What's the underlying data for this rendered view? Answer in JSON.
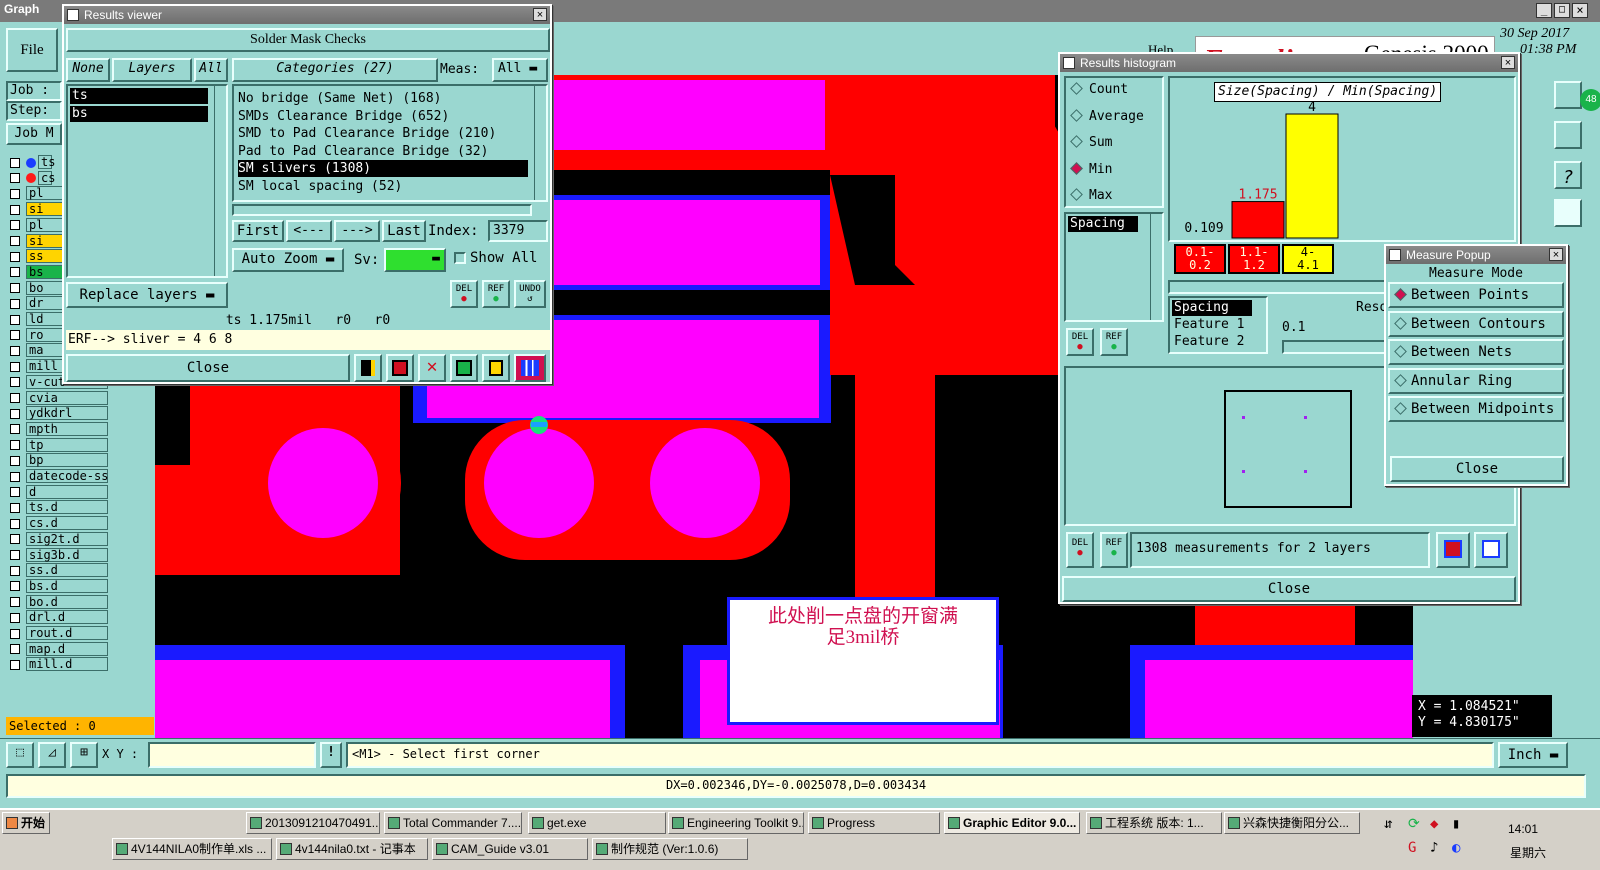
{
  "main_window": {
    "title": "Graph",
    "file_menu": "File",
    "job_label": "Job :",
    "step_label": "Step:",
    "job_btn": "Job M",
    "selected": "Selected : 0",
    "help": "Help",
    "brand_left": "Frontline",
    "brand": "Genesis 2000",
    "date": "30 Sep 2017",
    "time": "01:38 PM"
  },
  "layers": [
    {
      "name": "ts",
      "dot": "#1a3cff"
    },
    {
      "name": "cs",
      "dot": "#ff1a1a"
    },
    {
      "name": "pl"
    },
    {
      "name": "si",
      "color": "#ffd400"
    },
    {
      "name": "pl"
    },
    {
      "name": "si",
      "color": "#ffd400"
    },
    {
      "name": "ss",
      "color": "#ffd400"
    },
    {
      "name": "bs",
      "color": "#19b34a"
    },
    {
      "name": "bo"
    },
    {
      "name": "dr"
    },
    {
      "name": "ld"
    },
    {
      "name": "ro"
    },
    {
      "name": "ma"
    },
    {
      "name": "mill"
    },
    {
      "name": "v-cut"
    },
    {
      "name": "cvia"
    },
    {
      "name": "ydkdrl"
    },
    {
      "name": "mpth"
    },
    {
      "name": "tp"
    },
    {
      "name": "bp"
    },
    {
      "name": "datecode-ss"
    },
    {
      "name": "d"
    },
    {
      "name": "ts.d"
    },
    {
      "name": "cs.d"
    },
    {
      "name": "sig2t.d"
    },
    {
      "name": "sig3b.d"
    },
    {
      "name": "ss.d"
    },
    {
      "name": "bs.d"
    },
    {
      "name": "bo.d"
    },
    {
      "name": "drl.d"
    },
    {
      "name": "rout.d"
    },
    {
      "name": "map.d"
    },
    {
      "name": "mill.d"
    }
  ],
  "results_viewer": {
    "title": "Results viewer",
    "header": "Solder Mask Checks",
    "none_btn": "None",
    "layers_btn": "Layers",
    "all_btn": "All",
    "categories_btn": "Categories (27)",
    "meas_label": "Meas:",
    "meas_value": "All",
    "layer_items": [
      "ts",
      "bs"
    ],
    "categories": [
      "No bridge (Same Net) (168)",
      "SMDs Clearance Bridge (652)",
      "SMD to Pad Clearance Bridge (210)",
      "Pad to Pad Clearance Bridge (32)",
      "SM slivers (1308)",
      "SM local spacing (52)"
    ],
    "first": "First",
    "prev": "<---",
    "next": "--->",
    "last": "Last",
    "index_label": "Index:",
    "index_value": "3379",
    "auto_zoom": "Auto Zoom",
    "sv_label": "Sv:",
    "show_all": "Show All",
    "replace_layers": "Replace layers",
    "status1": "ts 1.175mil   r0   r0",
    "status2": "ERF--> sliver = 4 6 8",
    "close": "Close",
    "del": "DEL",
    "ref": "REF",
    "undo": "UNDO"
  },
  "histogram": {
    "title": "Results histogram",
    "stats": [
      "Count",
      "Average",
      "Sum",
      "Min",
      "Max"
    ],
    "selected_stat": "Min",
    "list_item": "Spacing",
    "chart_title": "Size(Spacing) / Min(Spacing)",
    "bar_labels": [
      "0.109",
      "1.175",
      "4"
    ],
    "bins": [
      "0.1-\n0.2",
      "1.1-\n1.2",
      "4-\n4.1"
    ],
    "spacing_fields": [
      "Spacing",
      "Feature 1",
      "Feature 2"
    ],
    "reso_label": "Reso",
    "reso_value": "0.1",
    "measurements": "1308 measurements for 2 layers",
    "close": "Close",
    "del": "DEL",
    "ref": "REF"
  },
  "chart_data": {
    "type": "bar",
    "title": "Size(Spacing) / Min(Spacing)",
    "categories": [
      "0.1-0.2",
      "1.1-1.2",
      "4-4.1"
    ],
    "values": [
      0.109,
      1.175,
      4
    ],
    "colors": [
      "#ff0000",
      "#ff0000",
      "#ffff00"
    ],
    "ylim": [
      0,
      4
    ]
  },
  "measure_popup": {
    "title": "Measure Popup",
    "mode": "Measure Mode",
    "options": [
      "Between Points",
      "Between Contours",
      "Between Nets",
      "Annular Ring",
      "Between Midpoints"
    ],
    "selected": "Between Points",
    "close": "Close"
  },
  "annotation": {
    "text": "此处削一点盘的开窗满\n足3mil桥"
  },
  "coords": {
    "x": "X = 1.084521\"",
    "y": "Y = 4.830175\""
  },
  "command_bar": {
    "xy_label": "X Y :",
    "message": "<M1> - Select first corner",
    "units": "Inch",
    "excl": "!"
  },
  "status_bar": {
    "text": "DX=0.002346,DY=-0.0025078,D=0.003434"
  },
  "taskbar": {
    "start": "开始",
    "row1": [
      "2013091210470491...",
      "Total Commander 7....",
      "get.exe",
      "Engineering Toolkit 9...",
      "Progress",
      "Graphic Editor 9.0...",
      "工程系统 版本: 1...",
      "兴森快捷衡阳分公..."
    ],
    "row2": [
      "4V144NILA0制作单.xls ...",
      "4v144nila0.txt - 记事本",
      "CAM_Guide v3.01",
      "制作规范 (Ver:1.0.6)"
    ],
    "clock": "14:01",
    "day": "星期六"
  }
}
